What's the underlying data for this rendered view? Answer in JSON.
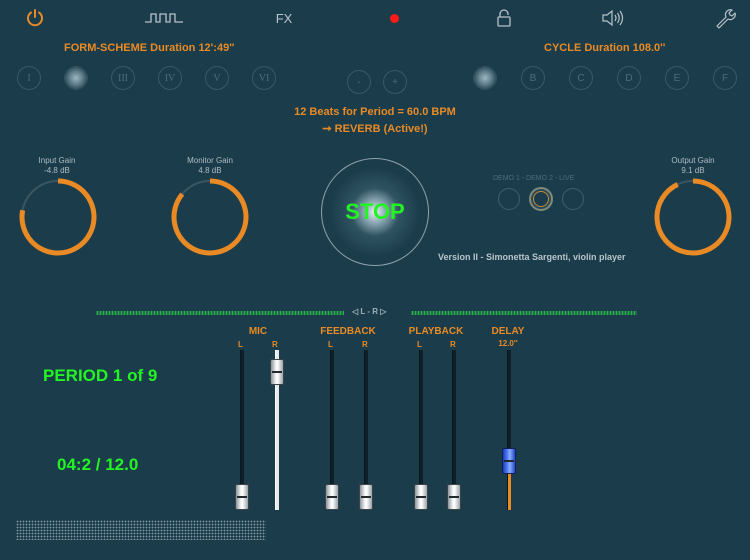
{
  "toolbar": {
    "fx_label": "FX",
    "icons": [
      "power-icon",
      "waveform-icon",
      "fx",
      "record-dot",
      "lock-icon",
      "speaker-icon",
      "wrench-icon"
    ],
    "colors": {
      "power": "#e98a25",
      "record": "#ff1a1a"
    }
  },
  "form_scheme": {
    "title": "FORM-SCHEME Duration 12':49''",
    "buttons": [
      "I",
      "II",
      "III",
      "IV",
      "V",
      "VI"
    ],
    "selected_index": 1,
    "minus_label": "-",
    "plus_label": "+"
  },
  "cycle": {
    "title": "CYCLE Duration 108.0''",
    "buttons": [
      "A",
      "B",
      "C",
      "D",
      "E",
      "F"
    ],
    "selected_index": 0
  },
  "status": {
    "beats": "12 Beats for Period = 60.0 BPM",
    "reverb": "➞ REVERB (Active!)"
  },
  "knobs": {
    "input": {
      "label": "Input Gain",
      "value": "-4.8 dB",
      "fill": 0.78
    },
    "monitor": {
      "label": "Monitor Gain",
      "value": "4.8 dB",
      "fill": 0.86
    },
    "output": {
      "label": "Output Gain",
      "value": "9.1 dB",
      "fill": 0.93
    }
  },
  "stop_label": "STOP",
  "demo": {
    "label": "DEMO 1 - DEMO 2 - LIVE",
    "selected_index": 1
  },
  "version": "Version II - Simonetta Sargenti, violin player",
  "meter": {
    "label": "◁ L - R ▷"
  },
  "mixer": {
    "mic": {
      "label": "MIC",
      "l": "L",
      "r": "R",
      "l_level": 0.0,
      "r_level": 0.93
    },
    "feedback": {
      "label": "FEEDBACK",
      "l": "L",
      "r": "R",
      "l_level": 0.0,
      "r_level": 0.0
    },
    "playback": {
      "label": "PLAYBACK",
      "l": "L",
      "r": "R",
      "l_level": 0.0,
      "r_level": 0.0
    },
    "delay": {
      "label": "DELAY",
      "value": "12.0''",
      "level": 0.27
    }
  },
  "period": "PERIOD 1 of 9",
  "time": "04:2 / 12.0"
}
